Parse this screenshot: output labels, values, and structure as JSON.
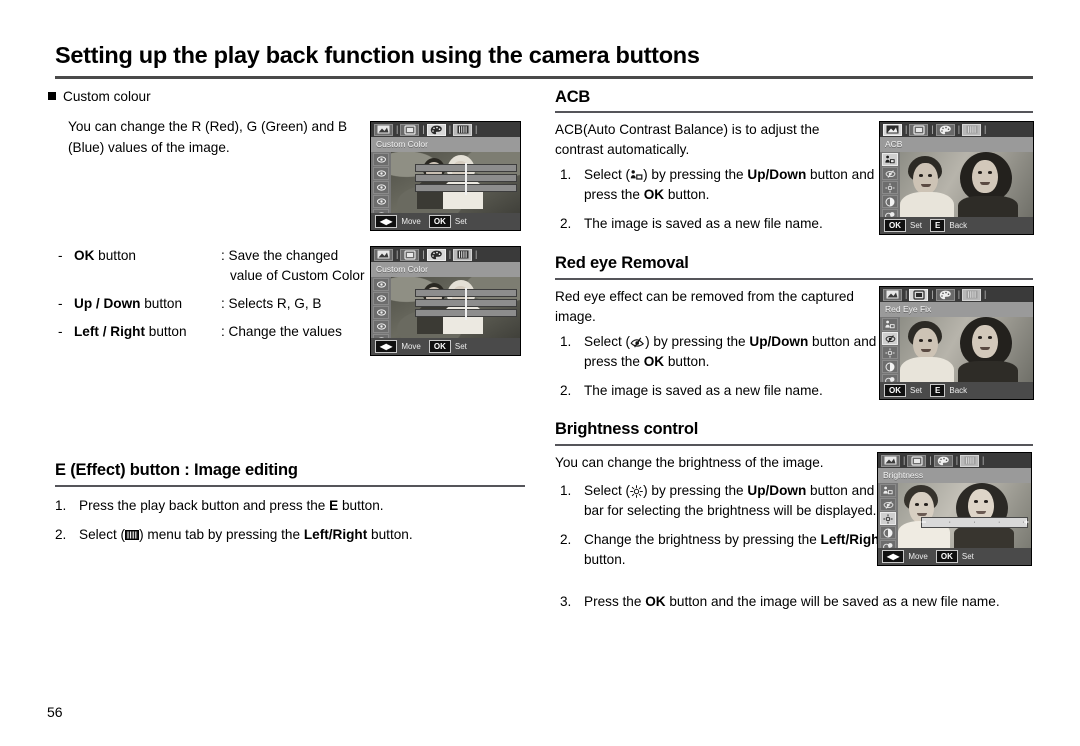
{
  "page": {
    "number": "56",
    "header_title": "Setting up the play back function using the camera buttons"
  },
  "left_column": {
    "bullet_label": "Custom colour",
    "intro": "You can change the R (Red), G (Green) and B (Blue) values of the image.",
    "key_rows": [
      {
        "dash": "-",
        "key_bold": "OK",
        "key_rest": " button",
        "value_line1": ": Save the changed",
        "value_line2": "value of Custom Color"
      },
      {
        "dash": "-",
        "key_bold": "Up / Down",
        "key_rest": " button",
        "value_line1": ": Selects R, G, B",
        "value_line2": ""
      },
      {
        "dash": "-",
        "key_bold": "Left / Right",
        "key_rest": " button",
        "value_line1": ": Change the values",
        "value_line2": ""
      }
    ],
    "effect_heading": "E (Effect) button : Image editing",
    "effect_steps": [
      {
        "n": "1.",
        "pre": "Press the play back button and press the ",
        "bold": "E",
        "post": " button."
      },
      {
        "n": "2.",
        "pre": "Select (",
        "icon": "menu-tab-icon",
        "mid": ") menu tab by pressing the ",
        "bold": "Left/Right",
        "post": " button."
      }
    ]
  },
  "right_column": {
    "acb": {
      "heading": "ACB",
      "body": "ACB(Auto Contrast Balance) is to adjust the contrast automatically.",
      "steps": [
        {
          "n": "1.",
          "pre": "Select (",
          "icon": "acb-icon",
          "mid": ") by pressing the ",
          "bold": "Up/Down",
          "post": " button and press the ",
          "bold2": "OK",
          "post2": " button."
        },
        {
          "n": "2.",
          "pre": "The image is saved as a new file name."
        }
      ]
    },
    "red_eye": {
      "heading": "Red eye Removal",
      "body": "Red eye effect can be removed from the captured image.",
      "steps": [
        {
          "n": "1.",
          "pre": "Select (",
          "icon": "red-eye-icon",
          "mid": ") by pressing the ",
          "bold": "Up/Down",
          "post": " button and press the ",
          "bold2": "OK",
          "post2": " button."
        },
        {
          "n": "2.",
          "pre": "The image is saved as a new file name."
        }
      ]
    },
    "brightness": {
      "heading": "Brightness control",
      "body": "You can change the brightness of the image.",
      "steps": [
        {
          "n": "1.",
          "pre": "Select (",
          "icon": "sun-icon",
          "mid": ") by pressing the ",
          "bold": "Up/Down",
          "post": " button and a bar for selecting the brightness will be displayed."
        },
        {
          "n": "2.",
          "pre": "Change the brightness by pressing the ",
          "bold": "Left/Right",
          "post": "  button."
        },
        {
          "n": "3.",
          "pre": "Press the ",
          "bold": "OK",
          "post": " button and the image will be saved as a new file name."
        }
      ]
    }
  },
  "lcd_screens": {
    "custom_color_1": {
      "title": "Custom Color",
      "tabs": [
        "resize-icon",
        "rotate-icon",
        "palette-icon",
        "menu-tab-icon"
      ],
      "selected_tab": 2,
      "sidebar_count": 6,
      "selected_sidebar": 5,
      "footer": [
        {
          "key": "◀▶",
          "label": "Move"
        },
        {
          "key": "OK",
          "label": "Set"
        }
      ]
    },
    "custom_color_2": {
      "title": "Custom Color",
      "tabs": [
        "resize-icon",
        "rotate-icon",
        "palette-icon",
        "menu-tab-icon"
      ],
      "selected_tab": 2,
      "sidebar_count": 6,
      "selected_sidebar": 5,
      "footer": [
        {
          "key": "◀▶",
          "label": "Move"
        },
        {
          "key": "OK",
          "label": "Set"
        }
      ]
    },
    "acb": {
      "title": "ACB",
      "tabs": [
        "resize-icon",
        "rotate-icon",
        "palette-icon",
        "menu-tab-icon"
      ],
      "selected_tab": 0,
      "sidebar_count": 5,
      "selected_sidebar": 0,
      "footer": [
        {
          "key": "OK",
          "label": "Set"
        },
        {
          "key": "E",
          "label": "Back"
        }
      ]
    },
    "red_eye": {
      "title": "Red Eye Fix",
      "tabs": [
        "resize-icon",
        "rotate-icon",
        "palette-icon",
        "menu-tab-icon"
      ],
      "selected_tab": 1,
      "sidebar_count": 5,
      "selected_sidebar": 1,
      "footer": [
        {
          "key": "OK",
          "label": "Set"
        },
        {
          "key": "E",
          "label": "Back"
        }
      ]
    },
    "brightness": {
      "title": "Brightness",
      "tabs": [
        "resize-icon",
        "rotate-icon",
        "palette-icon",
        "menu-tab-icon"
      ],
      "selected_tab": 3,
      "sidebar_count": 5,
      "selected_sidebar": 2,
      "slider": {
        "minus": "−",
        "plus": "+"
      },
      "footer": [
        {
          "key": "◀▶",
          "label": "Move"
        },
        {
          "key": "OK",
          "label": "Set"
        }
      ]
    }
  },
  "colors": {
    "rule": "#55555a",
    "title_rule": "#4a4a4a",
    "text": "#000000",
    "lcd_bg": "#6e6e6e",
    "lcd_titlebar": "#9a9a9a"
  }
}
